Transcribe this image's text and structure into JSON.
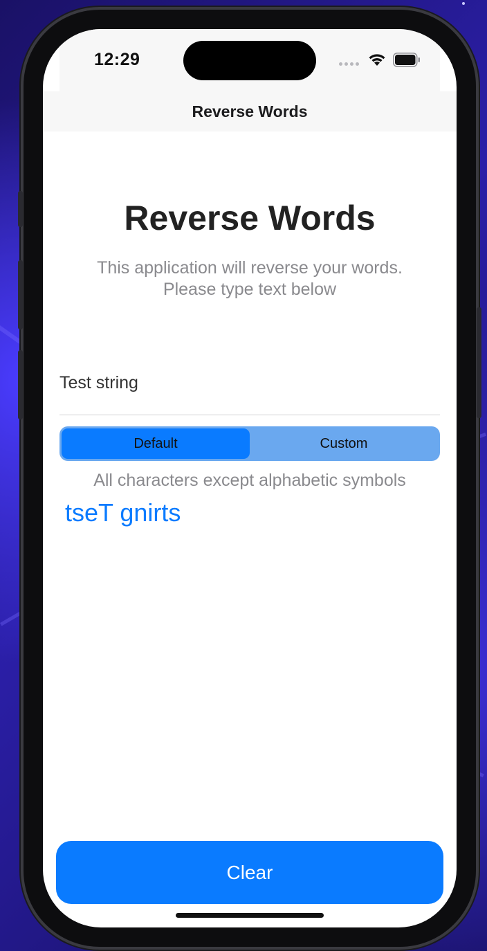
{
  "status_bar": {
    "time": "12:29"
  },
  "nav": {
    "title": "Reverse Words"
  },
  "main": {
    "heading": "Reverse Words",
    "subtitle_line1": "This application will reverse your words.",
    "subtitle_line2": "Please type text below",
    "input_value": "Test string",
    "segments": [
      {
        "label": "Default",
        "selected": true
      },
      {
        "label": "Custom",
        "selected": false
      }
    ],
    "hint": "All characters except alphabetic symbols",
    "result": "tseT gnirts"
  },
  "footer": {
    "clear_label": "Clear"
  },
  "colors": {
    "accent": "#0a7bff",
    "segment_track": "#6aa8ef",
    "secondary_text": "#8a8a8e"
  },
  "icons": [
    "wifi-icon",
    "battery-icon",
    "cellular-signal-icon"
  ]
}
